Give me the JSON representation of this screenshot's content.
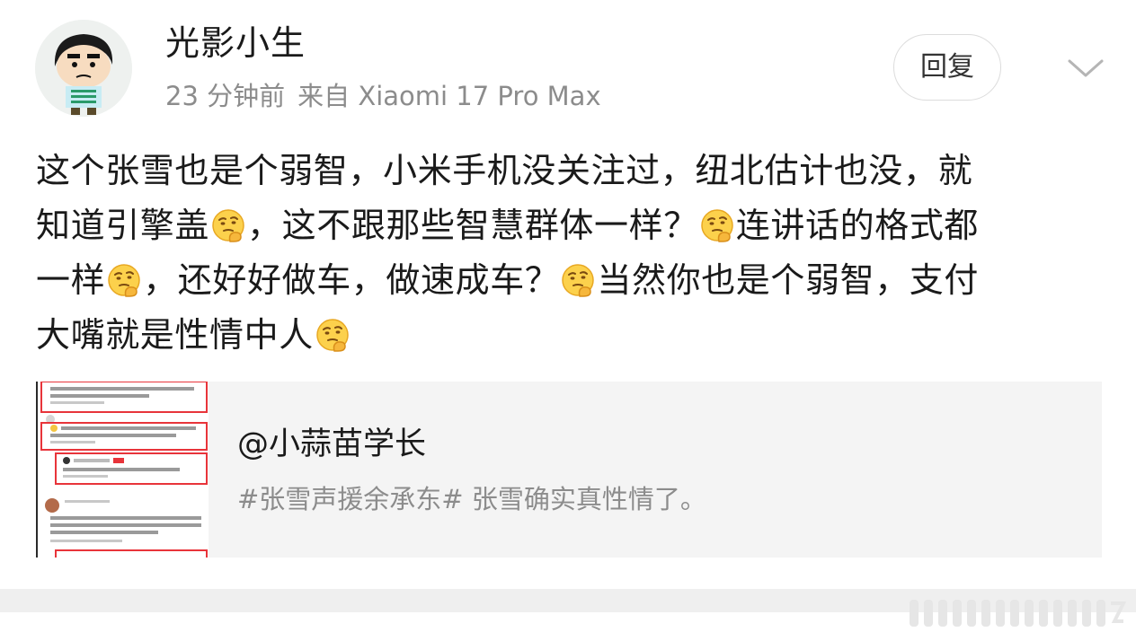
{
  "post": {
    "user_name": "光影小生",
    "time": "23 分钟前",
    "source": "来自 Xiaomi 17 Pro Max",
    "reply_label": "回复",
    "more_icon": "chevron-down-icon",
    "text_lines": [
      [
        "这个张雪也是个弱智，小米手机没关注过，纽北估计也没，就"
      ],
      [
        "知道引擎盖",
        "：emoji",
        "，这不跟那些智慧群体一样？",
        "：emoji",
        "连讲话的格式都"
      ],
      [
        "一样",
        "：emoji",
        "，还好好做车，做速成车？",
        "：emoji",
        "当然你也是个弱智，支付"
      ],
      [
        "大嘴就是性情中人",
        "：emoji"
      ]
    ],
    "emoji_icon": "thinking-face-emoji-icon"
  },
  "line1": "这个张雪也是个弱智，小米手机没关注过，纽北估计也没，就",
  "line2": {
    "a": "知道引擎盖",
    "b": "，这不跟那些智慧群体一样？",
    "c": "连讲话的格式都"
  },
  "line3": {
    "a": "一样",
    "b": "，还好好做车，做速成车？",
    "c": "当然你也是个弱智，支付"
  },
  "line4": {
    "a": "大嘴就是性情中人"
  },
  "repost": {
    "author": "@小蒜苗学长",
    "text": "#张雪声援余承东# 张雪确实真性情了。",
    "thumb_lines": [
      "小米手机就没有关注过，汽车就知道引擎盖的世",
      "界，说话被骗（不是真），就是没处理好。",
      "你现在体量不够，不要过多参与很多事情，目前",
      "就是专心把车做好，该量是一把孤刃剑!",
      "一定要把车做好，也要把人做好。",
      "就参和这事，这是一个组织行为，不是个人",
      "行为，黑子是收钱办事，没有立场，把组织",
      "整了，他们会整你的"
    ]
  },
  "colors": {
    "accent_red": "#e8343a",
    "meta_gray": "#8c8c8c",
    "card_bg": "#f4f4f4"
  }
}
